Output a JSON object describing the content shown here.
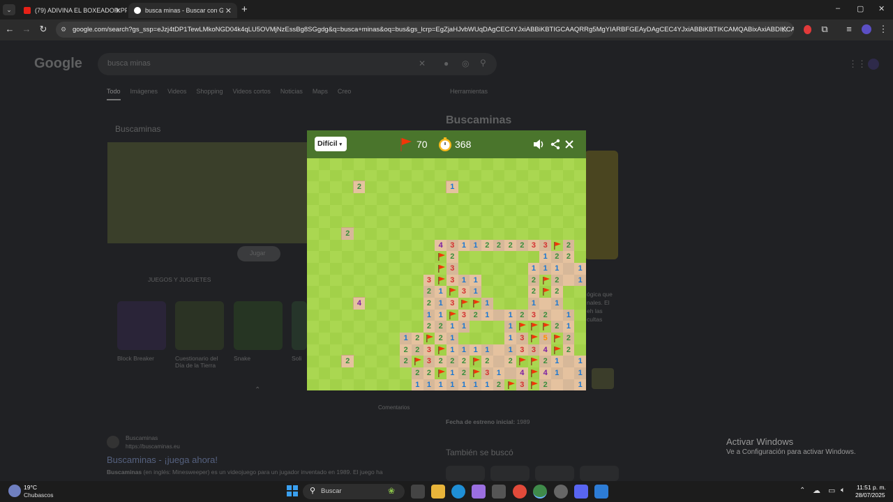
{
  "browser": {
    "tabs": [
      {
        "title": "(79) ADIVINA EL BOXEADOR PF",
        "active": false
      },
      {
        "title": "busca minas - Buscar con Goog",
        "active": true
      }
    ],
    "new_tab": "+",
    "window_controls": [
      "–",
      "▢",
      "✕"
    ],
    "url": "google.com/search?gs_ssp=eJzj4tDP1TewLMkoNGD04k4qLU5OVMjNzEssBg8SGgdg&q=busca+minas&oq=bus&gs_lcrp=EgZjaHJvbWUqDAgCEC4YJxiABBiKBTIGCAAQRRg5MgYIARBFGEAyDAgCEC4YJxiABBiKBTIKCAMQABixAxiABDIKCAQQABix..."
  },
  "google": {
    "logo": "Google",
    "query": "busca minas",
    "tabs": [
      "Todo",
      "Imágenes",
      "Videos",
      "Shopping",
      "Videos cortos",
      "Noticias",
      "Maps",
      "Creo"
    ],
    "tools": "Herramientas",
    "knowledge_title": "Buscaminas",
    "left_card_title": "Buscaminas",
    "play_button": "Jugar",
    "toys_heading": "JUEGOS Y JUGUETES",
    "games": [
      "Block Breaker",
      "Cuestionario del Día de la Tierra",
      "Snake",
      "Soli"
    ],
    "comment_link": "Comentarios",
    "result_site": "Buscaminas",
    "result_url": "https://buscaminas.eu",
    "result_title": "Buscaminas - ¡juega ahora!",
    "result_snippet_bold": "Buscaminas",
    "result_snippet": "(en inglés: Minesweeper) es un videojuego para un jugador inventado en 1989. El juego ha",
    "release_label": "Fecha de estreno inicial:",
    "release_value": "1989",
    "also_searched": "También se buscó",
    "side_text": [
      "ógica que",
      "nales. El",
      "eh las",
      "cultas"
    ]
  },
  "minesweeper": {
    "difficulty": "Difícil",
    "flags_left": "70",
    "timer": "368",
    "icons": [
      "flag-icon",
      "stopwatch-icon",
      "sound-icon",
      "share-icon",
      "close-icon"
    ],
    "colors": {
      "grass_light": "#aad751",
      "grass_dark": "#a2d149",
      "dirt_light": "#e5c29f",
      "dirt_dark": "#d7b899",
      "header": "#4a752c",
      "flag": "#f23607"
    },
    "cols": 24,
    "rows_visible": 20,
    "board": [
      "........................",
      "........................",
      "....2.......1...........",
      "........................",
      "........................",
      "........................",
      "...2....................",
      "...........4311222233F2.",
      "...........F2.......122.",
      "...........F3......111.1F",
      "..........3F311....2F2.11",
      "..........21F31....2F2...",
      "..........213FF1...1.1...",
      "..........11F321.1232 1..",
      "..........2211...1FFF21..",
      "........12F21....13F5F2..",
      "........223F1111.1334F2..",
      "........2F3222F2.2FF21 1.",
      ".........22F12F31 4F41 11",
      ".........11111112F3F2  1F"
    ],
    "revealed_rows_start": 7,
    "island_cells": [
      [
        2,
        4,
        "2"
      ],
      [
        2,
        12,
        "1"
      ],
      [
        6,
        3,
        "2"
      ],
      [
        12,
        4,
        "4"
      ],
      [
        17,
        3,
        "2"
      ]
    ]
  },
  "windows": {
    "activate_title": "Activar Windows",
    "activate_sub": "Ve a Configuración para activar Windows.",
    "weather_temp": "19°C",
    "weather_desc": "Chubascos",
    "search_placeholder": "Buscar",
    "time": "11:51 p. m.",
    "date": "28/07/2025"
  }
}
